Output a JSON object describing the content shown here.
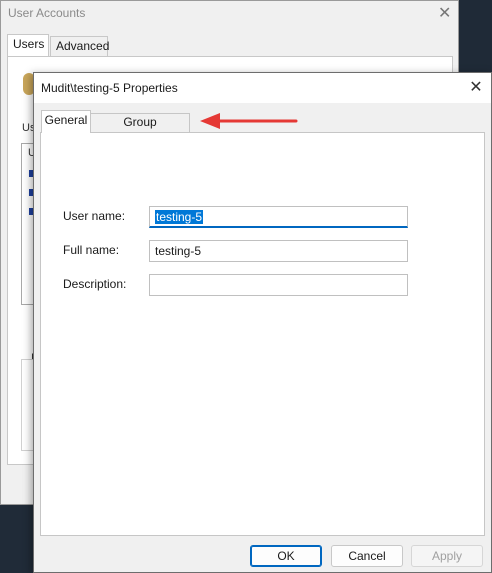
{
  "background_window": {
    "title": "User Accounts",
    "tabs": [
      {
        "label": "Users",
        "active": true
      },
      {
        "label": "Advanced",
        "active": false
      }
    ],
    "fragments": {
      "list_label": "Us",
      "frag2": "U",
      "frag3": "I"
    }
  },
  "dialog": {
    "title": "Mudit\\testing-5 Properties",
    "close_glyph": "✕",
    "tabs": [
      {
        "label": "General",
        "active": true
      },
      {
        "label": "Group Membership",
        "active": false
      }
    ],
    "fields": {
      "user_name": {
        "label": "User name:",
        "value": "testing-5"
      },
      "full_name": {
        "label": "Full name:",
        "value": "testing-5"
      },
      "description": {
        "label": "Description:",
        "value": ""
      }
    },
    "buttons": {
      "ok": "OK",
      "cancel": "Cancel",
      "apply": "Apply"
    }
  },
  "annotation": {
    "arrow_color": "#e53935",
    "points_to": "Group Membership tab"
  },
  "colors": {
    "selection": "#0078d7",
    "focus_underline": "#0067c0"
  }
}
